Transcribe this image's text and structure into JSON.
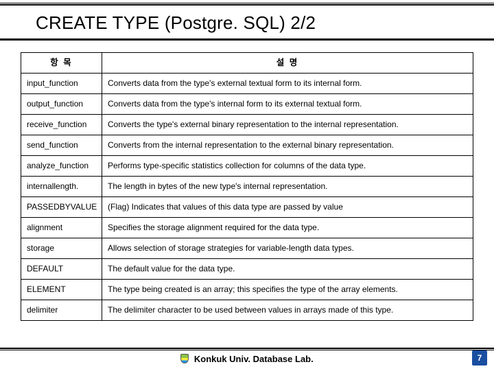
{
  "title": "CREATE TYPE (Postgre. SQL) 2/2",
  "headers": {
    "col1": "항 목",
    "col2": "설 명"
  },
  "rows": [
    {
      "item": "input_function",
      "desc": "Converts data from the type's external textual form to its internal form."
    },
    {
      "item": "output_function",
      "desc": "Converts data from the type's internal form to its external textual form."
    },
    {
      "item": "receive_function",
      "desc": "Converts the type's external binary representation to the internal representation."
    },
    {
      "item": "send_function",
      "desc": "Converts from the internal representation to the external binary representation."
    },
    {
      "item": "analyze_function",
      "desc": "Performs type-specific statistics collection for columns of the data type."
    },
    {
      "item": "internallength.",
      "desc": "The length in bytes of the new type's internal representation."
    },
    {
      "item": "PASSEDBYVALUE",
      "desc": "(Flag) Indicates that values of this data type are passed by value"
    },
    {
      "item": "alignment",
      "desc": "Specifies the storage alignment required for the data type."
    },
    {
      "item": "storage",
      "desc": "Allows selection of storage strategies for variable-length data types."
    },
    {
      "item": "DEFAULT",
      "desc": "The default value for the data type."
    },
    {
      "item": "ELEMENT",
      "desc": "The type being created is an array; this specifies the type of the array elements."
    },
    {
      "item": "delimiter",
      "desc": "The delimiter character to be used between values in arrays made of this type."
    }
  ],
  "footer": "Konkuk Univ. Database Lab.",
  "page": "7"
}
